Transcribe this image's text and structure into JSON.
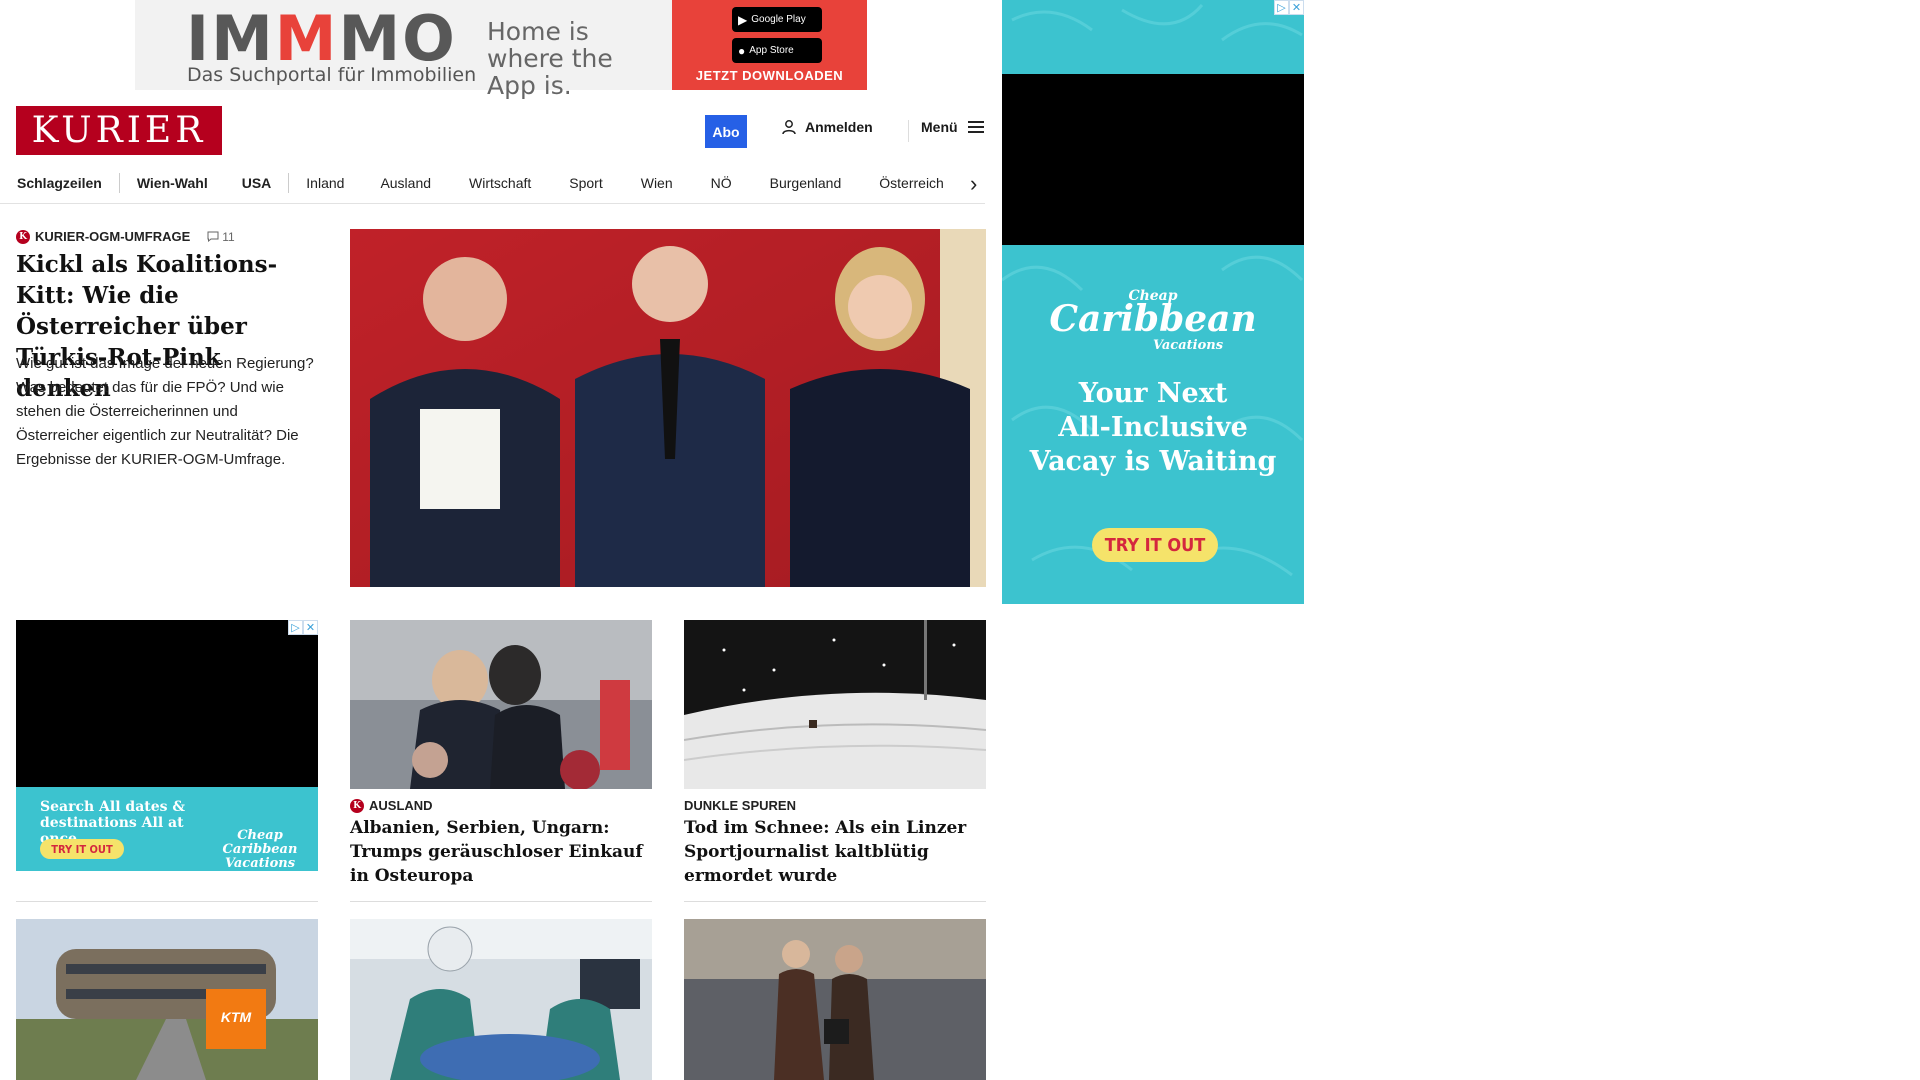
{
  "top_ad": {
    "brand": "IMMMO",
    "brand_sub": "Das Suchportal für Immobilien",
    "tagline": "Home is where the App is.",
    "google_play": "Google Play",
    "app_store": "App Store",
    "cta": "JETZT DOWNLOADEN",
    "cta_color": "#e8423a"
  },
  "header": {
    "logo": "KURIER",
    "logo_color": "#b5001e",
    "abo": "Abo",
    "abo_color": "#2660e6",
    "login": "Anmelden",
    "menu": "Menü"
  },
  "nav": {
    "items": [
      "Schlagzeilen",
      "Wien-Wahl",
      "USA",
      "Inland",
      "Ausland",
      "Wirtschaft",
      "Sport",
      "Wien",
      "NÖ",
      "Burgenland",
      "Österreich"
    ]
  },
  "lead": {
    "kicker": "KURIER-OGM-UMFRAGE",
    "comment_count": "11",
    "title": "Kickl als Koalitions-Kitt: Wie die Österreicher über Türkis-Rot-Pink denken",
    "description": "Wie gut ist das Image der neuen Regierung? Was bedeutet das für die FPÖ? Und wie stehen die Österreicherinnen und Österreicher eigentlich zur Neutralität? Die Ergebnisse der KURIER-OGM-Umfrage."
  },
  "cards": [
    {
      "kicker": "AUSLAND",
      "title": "Albanien, Serbien, Ungarn: Trumps geräuschloser Einkauf in Osteuropa"
    },
    {
      "kicker": "DUNKLE SPUREN",
      "title": "Tod im Schnee: Als ein Linzer Sportjournalist kaltblütig ermordet wurde"
    }
  ],
  "small_ad": {
    "headline": "Search All dates & destinations All at once",
    "cta": "TRY IT OUT",
    "logo": "Cheap Caribbean Vacations"
  },
  "right_ad": {
    "logo_top": "Cheap",
    "logo_main": "Caribbean",
    "logo_bottom": "Vacations",
    "headline_1": "Your Next",
    "headline_2": "All-Inclusive",
    "headline_3": "Vacay is Waiting",
    "cta": "TRY IT OUT",
    "teal_color": "#3cc3cf"
  }
}
